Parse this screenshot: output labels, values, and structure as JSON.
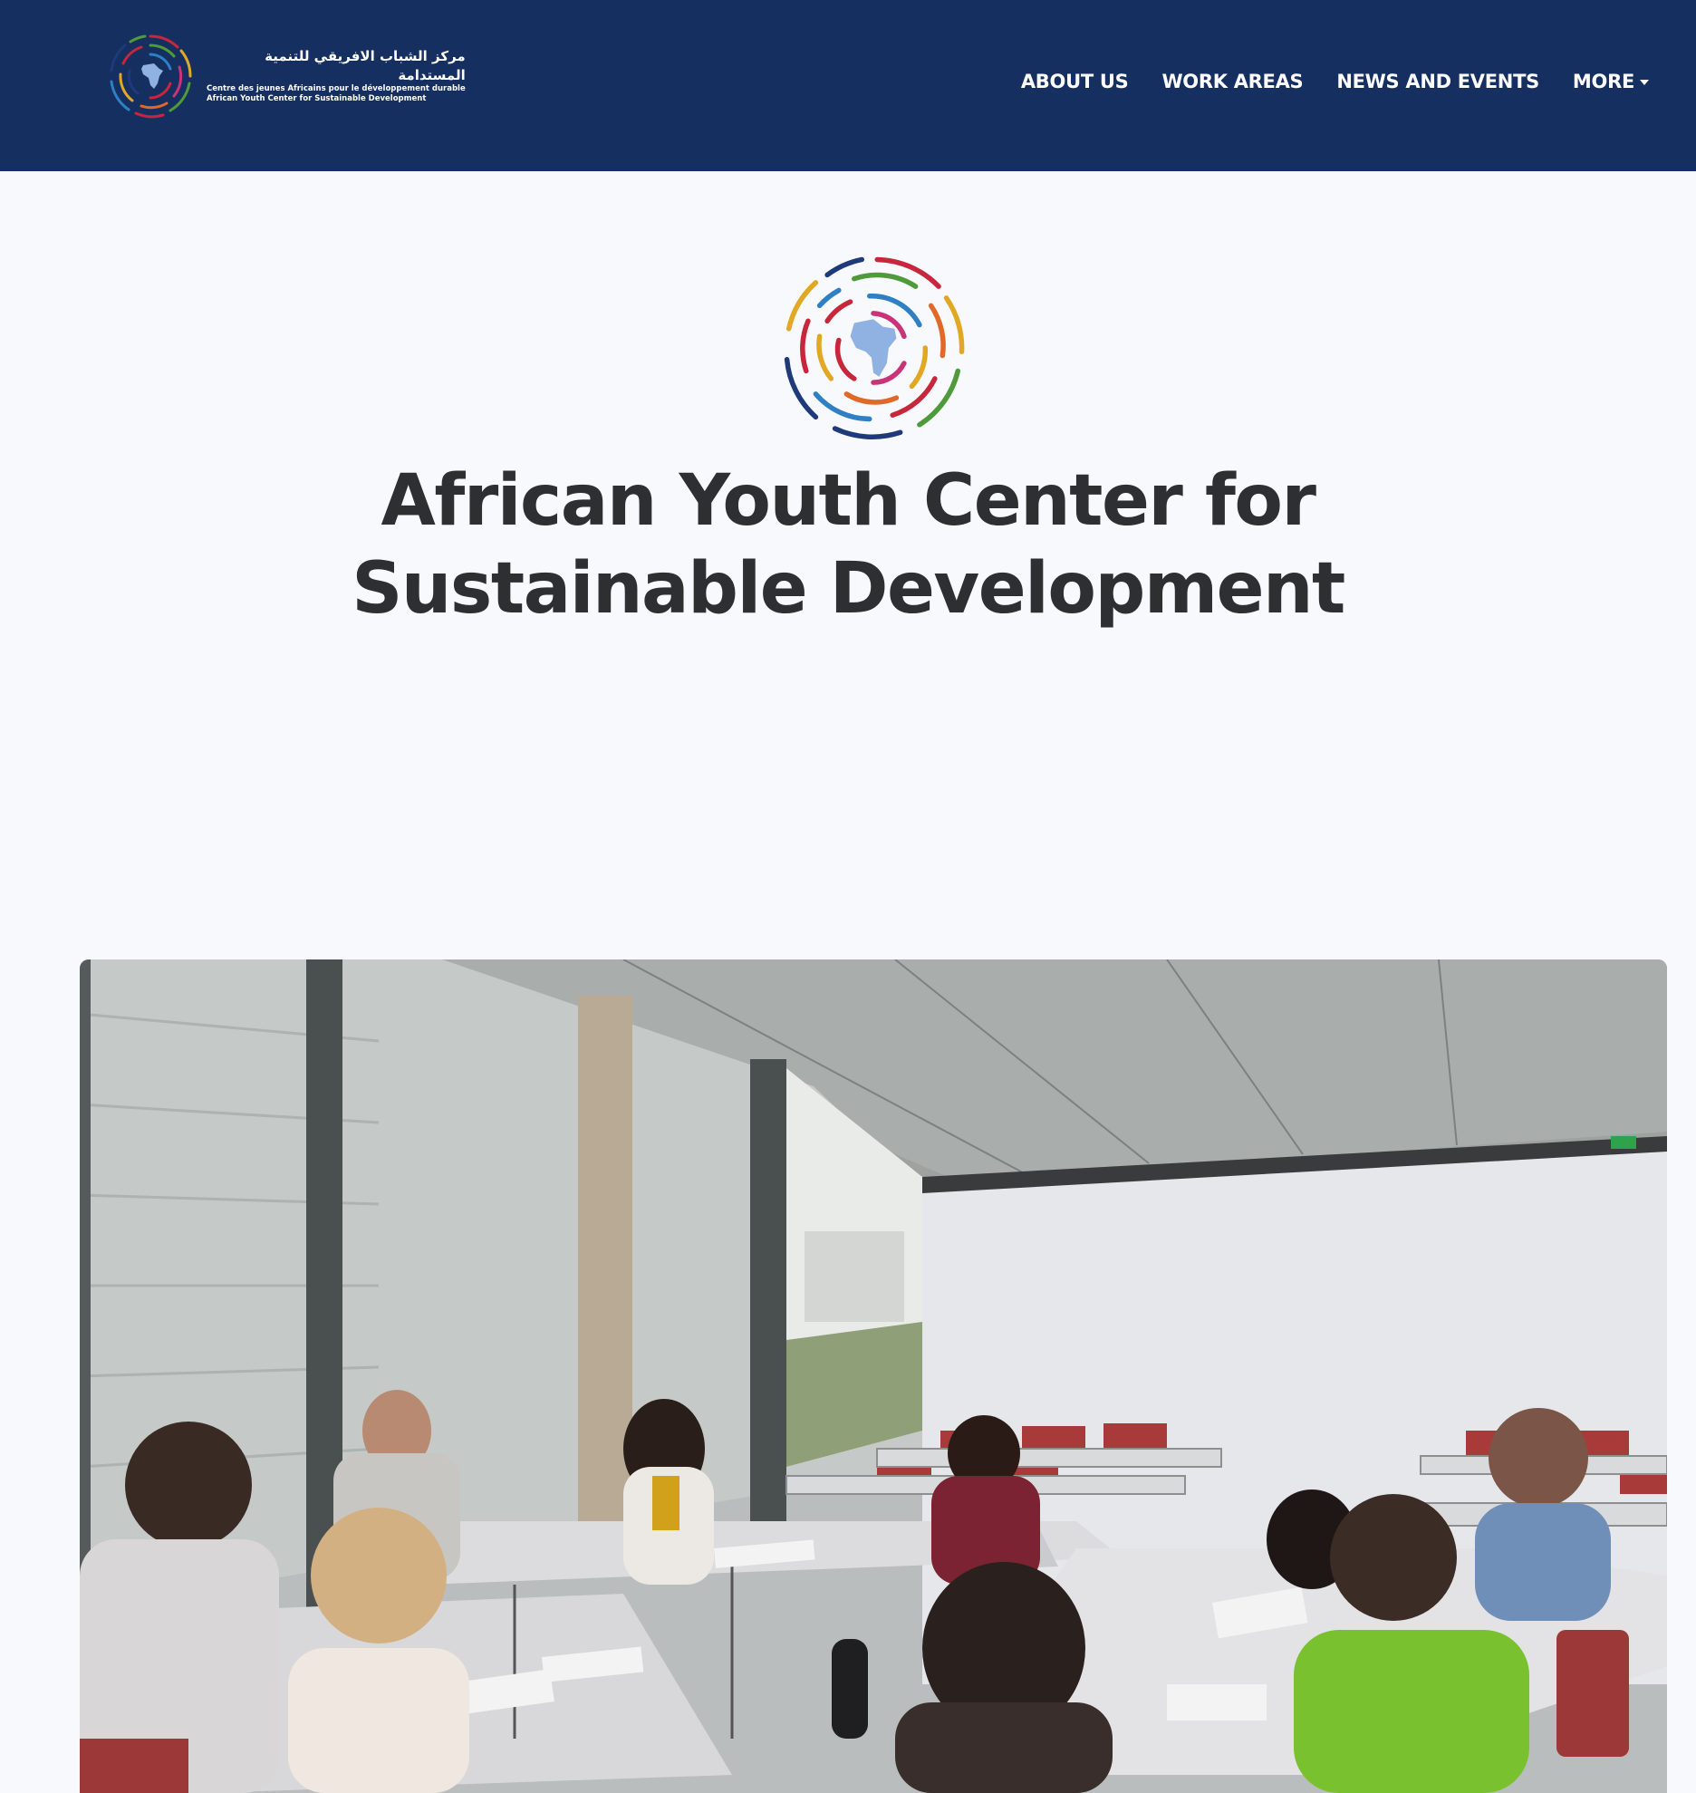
{
  "navbar": {
    "background": "#152f61",
    "brand": {
      "arabic": "مركز الشباب الافريقي للتنمية المستدامة",
      "french": "Centre des jeunes Africains pour le développement durable",
      "english": "African Youth Center for Sustainable Development",
      "icon": "circular-rings-africa-logo"
    },
    "links": [
      {
        "label": "ABOUT US"
      },
      {
        "label": "WORK AREAS"
      },
      {
        "label": "NEWS AND EVENTS"
      },
      {
        "label": "MORE",
        "icon": "caret-down-icon"
      }
    ]
  },
  "hero": {
    "logo_icon": "circular-rings-africa-logo",
    "title_line1": "African Youth Center for",
    "title_line2": "Sustainable Development"
  },
  "photo": {
    "subject": "workshop-classroom-photo"
  },
  "colors": {
    "ring_navy": "#1f3a7a",
    "ring_blue": "#2f7fc4",
    "ring_green": "#4f9a3a",
    "ring_red": "#c8263a",
    "ring_yellow": "#e2a825",
    "ring_orange": "#e0692a",
    "ring_pink": "#c93479",
    "africa": "#8fb2e3"
  }
}
